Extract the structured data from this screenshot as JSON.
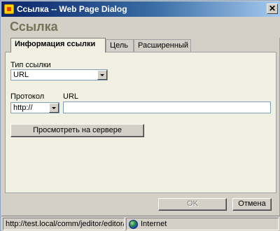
{
  "window": {
    "title": "Ссылка -- Web Page Dialog",
    "close_symbol": "✕"
  },
  "dialog": {
    "heading": "Ссылка"
  },
  "tabs": [
    {
      "label": "Информация ссылки",
      "active": true
    },
    {
      "label": "Цель",
      "active": false
    },
    {
      "label": "Расширенный",
      "active": false
    }
  ],
  "form": {
    "link_type_label": "Тип ссылки",
    "link_type_value": "URL",
    "protocol_label": "Протокол",
    "protocol_value": "http://",
    "url_label": "URL",
    "url_value": "",
    "browse_server_label": "Просмотреть на сервере"
  },
  "footer": {
    "ok_label": "OK",
    "cancel_label": "Отмена"
  },
  "statusbar": {
    "url": "http://test.local/comm/jeditor/editor/",
    "zone": "Internet"
  },
  "icons": {
    "app": "page-dialog-icon",
    "zone": "globe-icon",
    "dropdown": "chevron-down-icon"
  }
}
